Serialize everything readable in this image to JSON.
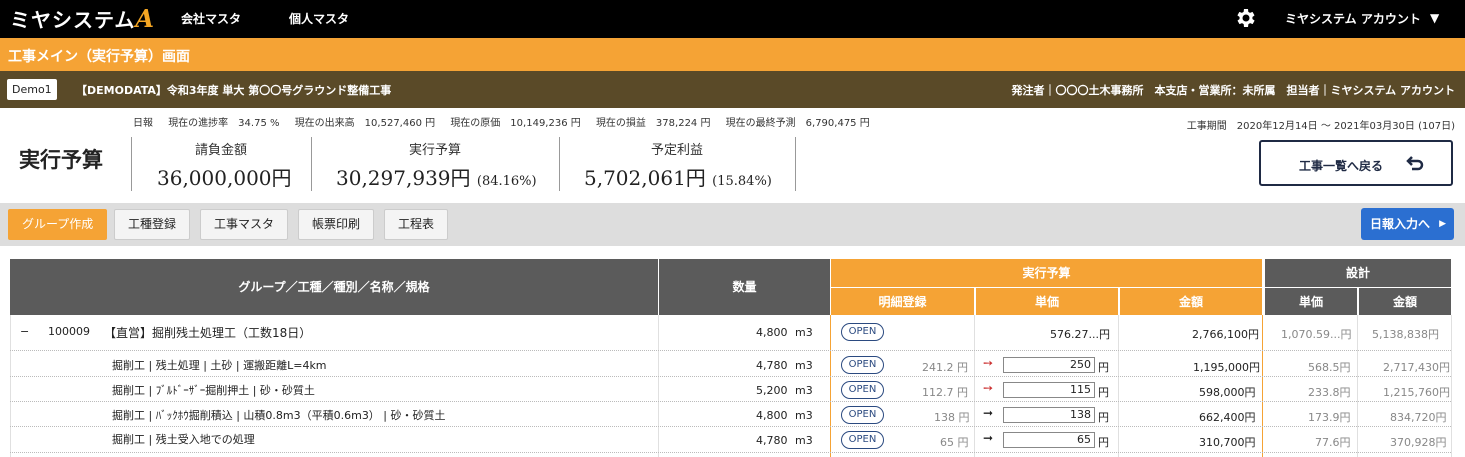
{
  "app": {
    "logo_main": "ミヤシステム",
    "logo_accent": "A",
    "nav": [
      "会社マスタ",
      "個人マスタ"
    ],
    "account": "ミヤシステム アカウント",
    "screen_title": "工事メイン（実行予算）画面"
  },
  "project": {
    "code": "Demo1",
    "name": "【DEMODATA】令和3年度 単大 第〇〇号グラウンド整備工事",
    "right_info": "発注者｜〇〇〇土木事務所　本支店・営業所：未所属　担当者｜ミヤシステム アカウント"
  },
  "stats": {
    "items": [
      "日報",
      "現在の進捗率　34.75 %",
      "現在の出来高　10,527,460 円",
      "現在の原価　10,149,236 円",
      "現在の損益　378,224 円",
      "現在の最終予測　6,790,475 円"
    ],
    "period": "工事期間　2020年12月14日 〜 2021年03月30日 (107日)"
  },
  "summary": {
    "title": "実行予算",
    "contract_label": "請負金額",
    "contract_value": "36,000,000円",
    "budget_label": "実行予算",
    "budget_value": "30,297,939円",
    "budget_pct": "(84.16%)",
    "profit_label": "予定利益",
    "profit_value": "5,702,061円",
    "profit_pct": "(15.84%)",
    "back_button": "工事一覧へ戻る"
  },
  "toolbar": {
    "buttons": [
      "グループ作成",
      "工種登録",
      "工事マスタ",
      "帳票印刷",
      "工程表"
    ],
    "nippo": "日報入力へ"
  },
  "table": {
    "headers": {
      "name": "グループ／工種／種別／名称／規格",
      "qty": "数量",
      "budget_group": "実行予算",
      "detail": "明細登録",
      "unit_price": "単価",
      "amount": "金額",
      "design_group": "設計",
      "design_unit": "単価",
      "design_amount": "金額"
    },
    "group_row": {
      "toggle": "−",
      "code": "100009",
      "name": "【直営】掘削残土処理工（工数18日）",
      "qty": "4,800",
      "unit": "m3",
      "open": "OPEN",
      "unit_price": "576.27...円",
      "amount": "2,766,100円",
      "design_unit": "1,070.59...円",
      "design_amount": "5,138,838円"
    },
    "rows": [
      {
        "name": "掘削工 | 残土処理 | 土砂 | 運搬距離L=4km",
        "qty": "4,780",
        "unit": "m3",
        "open": "OPEN",
        "detail_price": "241.2 円",
        "arrow": "➙",
        "input": "250",
        "yen": "円",
        "amount": "1,195,000円",
        "design_unit": "568.5円",
        "design_amount": "2,717,430円"
      },
      {
        "name": "掘削工 | ﾌﾞﾙﾄﾞｰｻﾞｰ掘削押土 | 砂・砂質土",
        "qty": "5,200",
        "unit": "m3",
        "open": "OPEN",
        "detail_price": "112.7 円",
        "arrow": "➙",
        "input": "115",
        "yen": "円",
        "amount": "598,000円",
        "design_unit": "233.8円",
        "design_amount": "1,215,760円"
      },
      {
        "name": "掘削工 | ﾊﾞｯｸﾎｳ掘削積込 | 山積0.8m3（平積0.6m3） | 砂・砂質土",
        "qty": "4,800",
        "unit": "m3",
        "open": "OPEN",
        "detail_price": "138 円",
        "arrow": "➞",
        "input": "138",
        "yen": "円",
        "amount": "662,400円",
        "design_unit": "173.9円",
        "design_amount": "834,720円"
      },
      {
        "name": "掘削工 | 残土受入地での処理",
        "qty": "4,780",
        "unit": "m3",
        "open": "OPEN",
        "detail_price": "65 円",
        "arrow": "➞",
        "input": "65",
        "yen": "円",
        "amount": "310,700円",
        "design_unit": "77.6円",
        "design_amount": "370,928円"
      }
    ]
  },
  "colors": {
    "orange": "#f5a335",
    "brown": "#5a4a28",
    "header_gray": "#5b5b5b",
    "blue": "#2b6fd1",
    "navy": "#1f2a44"
  }
}
